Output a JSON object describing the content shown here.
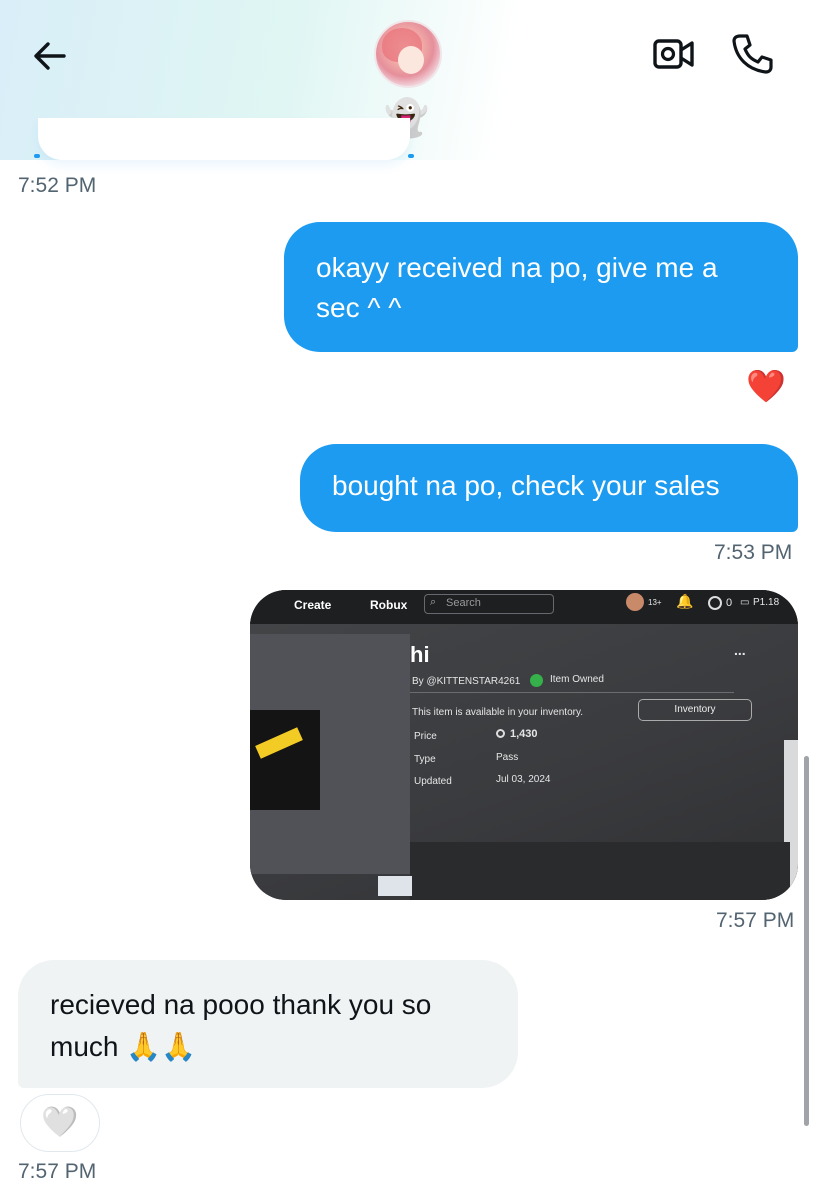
{
  "header": {
    "back_icon": "arrow-left-icon",
    "avatar": "contact-avatar",
    "status_emoji": "👻",
    "video_icon": "video-call-icon",
    "phone_icon": "phone-call-icon"
  },
  "messages": [
    {
      "kind": "timestamp",
      "text": "7:52 PM"
    },
    {
      "kind": "outgoing",
      "text": "okayy received na po, give me a sec ^ ^",
      "reaction": "❤️"
    },
    {
      "kind": "outgoing",
      "text": "bought na po, check your sales",
      "time": "7:53 PM"
    },
    {
      "kind": "outgoing-image",
      "time": "7:57 PM",
      "image_text": {
        "nav_create": "Create",
        "nav_robux": "Robux",
        "search_placeholder": "Search",
        "age_badge": "13+",
        "robux_count": "0",
        "balance": "P1.18",
        "title": "hi",
        "by": "By @KITTENSTAR4261",
        "owned": "Item Owned",
        "available": "This item is available in your inventory.",
        "inventory_button": "Inventory",
        "price_label": "Price",
        "price_value": "1,430",
        "type_label": "Type",
        "type_value": "Pass",
        "updated_label": "Updated",
        "updated_value": "Jul 03, 2024",
        "more": "..."
      }
    },
    {
      "kind": "incoming",
      "text": "recieved na pooo thank you so much 🙏🙏",
      "reaction_button": "🤍",
      "time": "7:57 PM"
    }
  ],
  "colors": {
    "outgoing": "#1d9bf0",
    "incoming": "#eff3f4",
    "timestamp": "#536471"
  }
}
